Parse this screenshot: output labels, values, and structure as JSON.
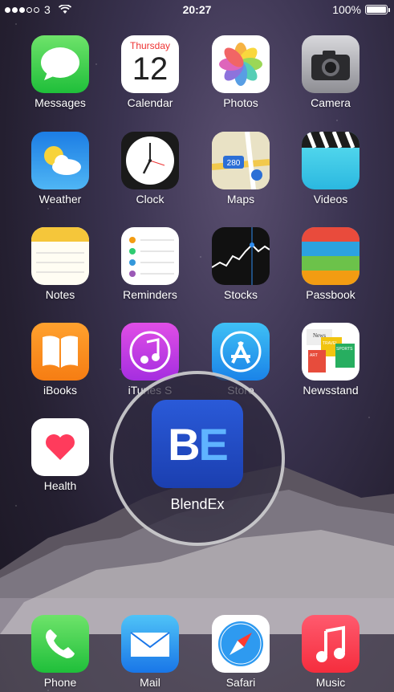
{
  "status": {
    "carrier": "3",
    "time": "20:27",
    "battery": "100%",
    "battery_level": 1.0,
    "signal_bars_filled": 3,
    "signal_bars_total": 5
  },
  "apps": [
    {
      "label": "Messages"
    },
    {
      "label": "Calendar",
      "day": "Thursday",
      "date": "12"
    },
    {
      "label": "Photos"
    },
    {
      "label": "Camera"
    },
    {
      "label": "Weather"
    },
    {
      "label": "Clock"
    },
    {
      "label": "Maps",
      "road": "280"
    },
    {
      "label": "Videos"
    },
    {
      "label": "Notes"
    },
    {
      "label": "Reminders"
    },
    {
      "label": "Stocks"
    },
    {
      "label": "Passbook"
    },
    {
      "label": "iBooks"
    },
    {
      "label": "iTunes S"
    },
    {
      "label": "Store"
    },
    {
      "label": "Newsstand",
      "paper": "News",
      "mag1": "TRAVEL",
      "mag2": "SPORTS",
      "mag3": "ART"
    },
    {
      "label": "Health"
    }
  ],
  "focused_app": {
    "label": "BlendEx",
    "icon_text_1": "B",
    "icon_text_2": "E"
  },
  "dock": [
    {
      "label": "Phone"
    },
    {
      "label": "Mail"
    },
    {
      "label": "Safari"
    },
    {
      "label": "Music"
    }
  ]
}
